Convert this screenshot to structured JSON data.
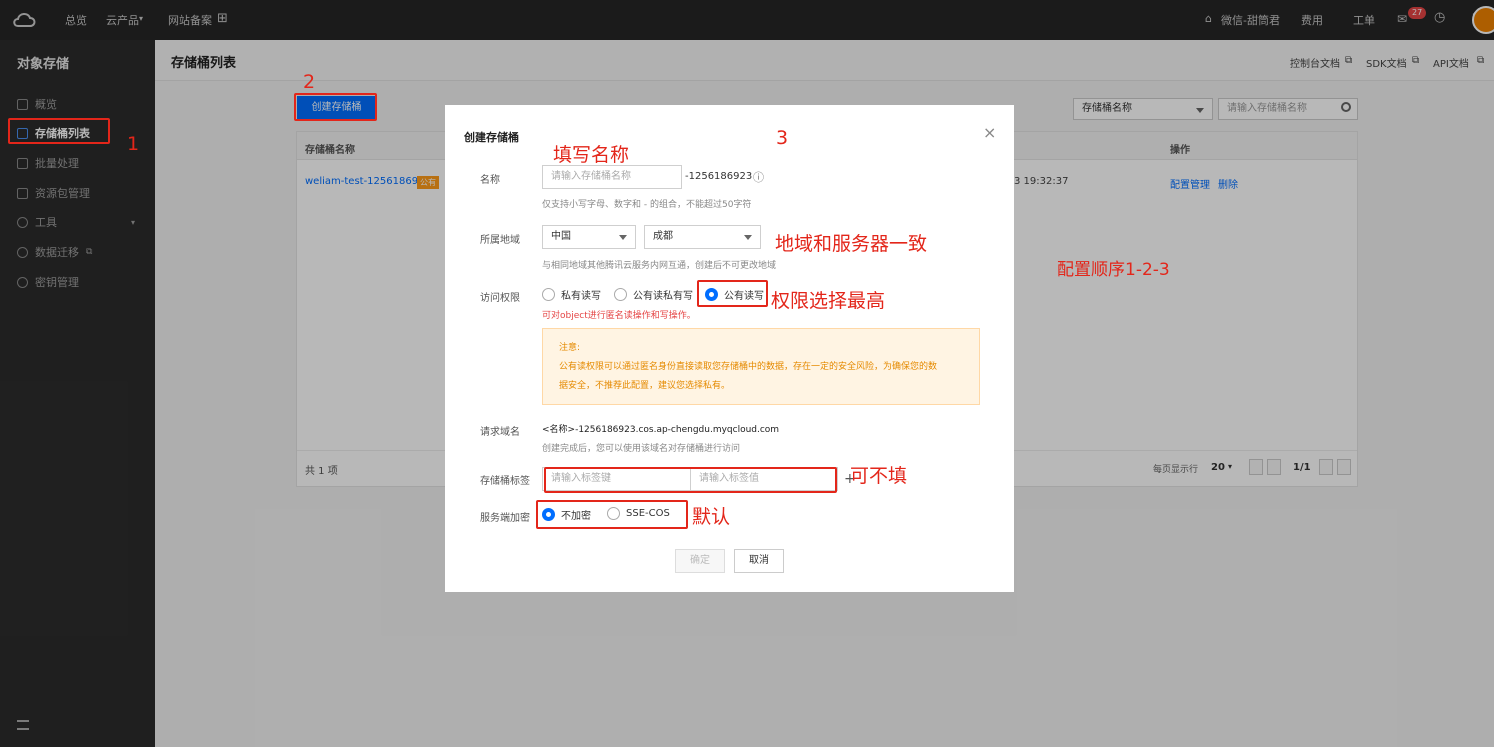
{
  "topbar": {
    "nav_overview": "总览",
    "nav_products": "云产品",
    "nav_beian": "网站备案",
    "user": "微信-甜筒君",
    "cost": "费用",
    "ticket": "工单",
    "message_count": "27"
  },
  "sidebar": {
    "title": "对象存储",
    "items": [
      {
        "label": "概览"
      },
      {
        "label": "存储桶列表"
      },
      {
        "label": "批量处理"
      },
      {
        "label": "资源包管理"
      },
      {
        "label": "工具"
      },
      {
        "label": "数据迁移"
      },
      {
        "label": "密钥管理"
      }
    ]
  },
  "header": {
    "title": "存储桶列表",
    "console_doc": "控制台文档",
    "sdk_doc": "SDK文档",
    "api_doc": "API文档"
  },
  "toolbar": {
    "create_label": "创建存储桶",
    "search_select": "存储桶名称",
    "search_placeholder": "请输入存储桶名称"
  },
  "table": {
    "col_name": "存储桶名称",
    "col_ops": "操作",
    "row": {
      "name": "weliam-test-1256186923",
      "tag": "公有",
      "time": "3 19:32:37",
      "op_config": "配置管理",
      "op_delete": "删除"
    },
    "total": "共 1 项",
    "per_page_label": "每页显示行",
    "per_page": "20",
    "page": "1/1"
  },
  "modal": {
    "title": "创建存储桶",
    "close": "×",
    "name_label": "名称",
    "name_placeholder": "请输入存储桶名称",
    "name_suffix": "-1256186923",
    "name_hint": "仅支持小写字母、数字和 - 的组合，不能超过50字符",
    "region_label": "所属地域",
    "region_country": "中国",
    "region_city": "成都",
    "region_hint": "与相同地域其他腾讯云服务内网互通，创建后不可更改地域",
    "access_label": "访问权限",
    "access_private": "私有读写",
    "access_public_read": "公有读私有写",
    "access_public_rw": "公有读写",
    "access_warn_red": "可对object进行匿名读操作和写操作。",
    "notice_title": "注意:",
    "notice_line1": "公有读权限可以通过匿名身份直接读取您存储桶中的数据，存在一定的安全风险，为确保您的数",
    "notice_line2": "据安全，不推荐此配置，建议您选择私有。",
    "domain_label": "请求域名",
    "domain_value": "<名称>-1256186923.cos.ap-chengdu.myqcloud.com",
    "domain_hint": "创建完成后，您可以使用该域名对存储桶进行访问",
    "tag_label": "存储桶标签",
    "tag_key_placeholder": "请输入标签键",
    "tag_value_placeholder": "请输入标签值",
    "tag_add": "+",
    "encrypt_label": "服务端加密",
    "encrypt_none": "不加密",
    "encrypt_sse": "SSE-COS",
    "confirm": "确定",
    "cancel": "取消"
  },
  "annotations": {
    "step1": "1",
    "step2": "2",
    "step3": "3",
    "fill_name": "填写名称",
    "region_note": "地域和服务器一致",
    "order_note": "配置顺序1-2-3",
    "perm_note": "权限选择最高",
    "optional_note": "可不填",
    "default_note": "默认"
  },
  "colors": {
    "accent": "#006eff",
    "annotation_red": "#e3261a",
    "warning_bg": "#fff4e3"
  }
}
